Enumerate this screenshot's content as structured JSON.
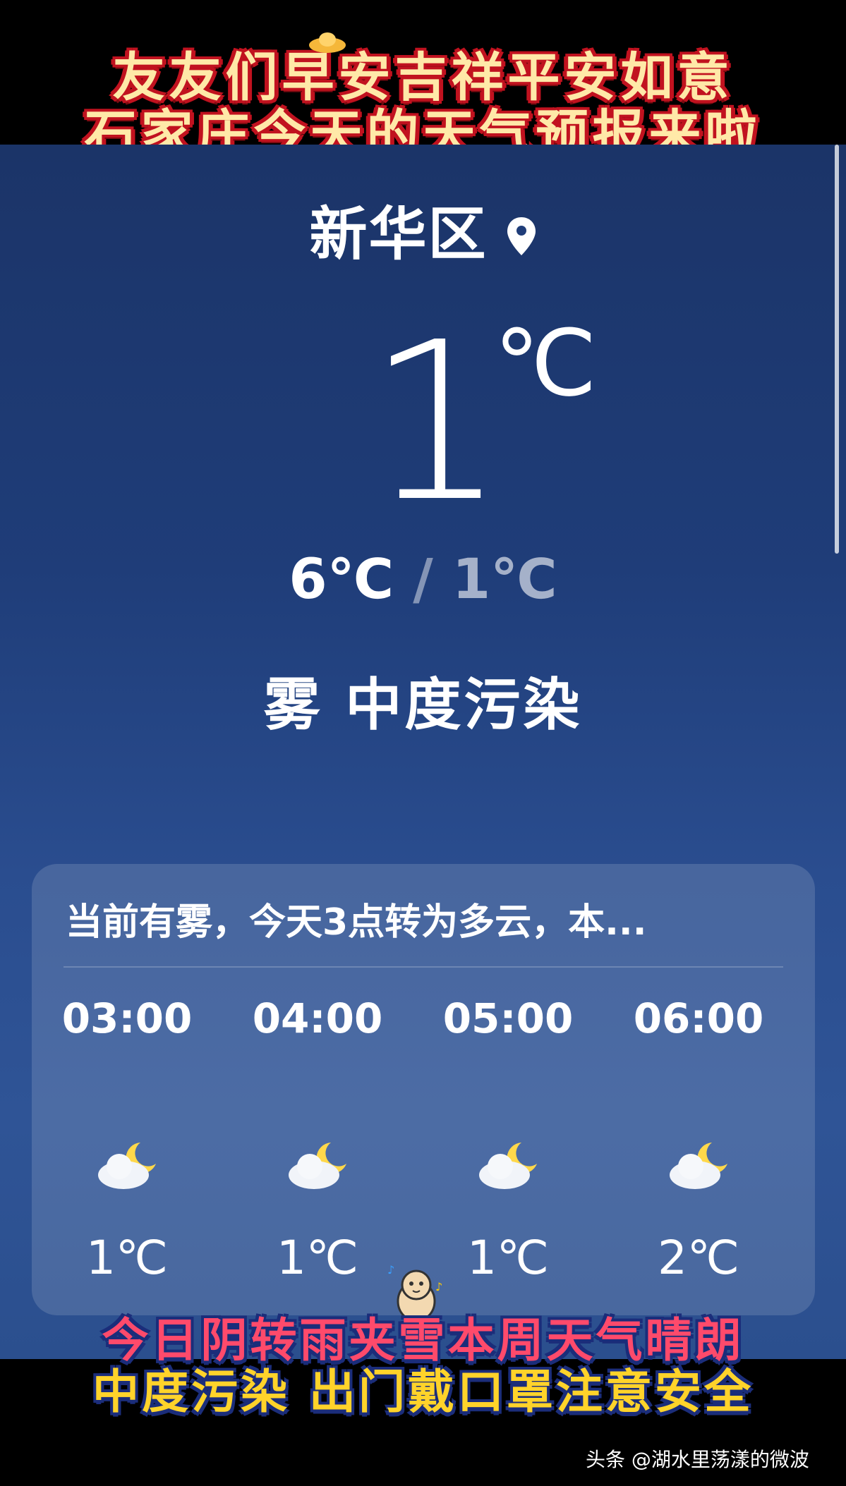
{
  "banner_top": {
    "line1": "友友们早安吉祥平安如意",
    "line2": "石家庄今天的天气预报来啦"
  },
  "weather": {
    "location": "新华区",
    "current_temp": "1",
    "temp_unit": "℃",
    "high": "6℃",
    "separator": " / ",
    "low": "1℃",
    "condition": "雾  中度污染"
  },
  "forecast_card": {
    "summary": "当前有雾，今天3点转为多云，本...",
    "hours": [
      {
        "time": "03:00",
        "icon": "cloudy-night-icon",
        "temp": "1℃"
      },
      {
        "time": "04:00",
        "icon": "cloudy-night-icon",
        "temp": "1℃"
      },
      {
        "time": "05:00",
        "icon": "cloudy-night-icon",
        "temp": "1℃"
      },
      {
        "time": "06:00",
        "icon": "cloudy-night-icon",
        "temp": "2℃"
      }
    ]
  },
  "banner_bottom": {
    "line1": "今日阴转雨夹雪本周天气晴朗",
    "line2": "中度污染  出门戴口罩注意安全"
  },
  "watermark": "头条 @湖水里荡漾的微波",
  "colors": {
    "app_bg_top": "#1b3468",
    "app_bg_bottom": "#2f5496",
    "banner_red": "#c1121f",
    "banner_gold": "#ffe9a8",
    "moon_yellow": "#ffd84a"
  }
}
